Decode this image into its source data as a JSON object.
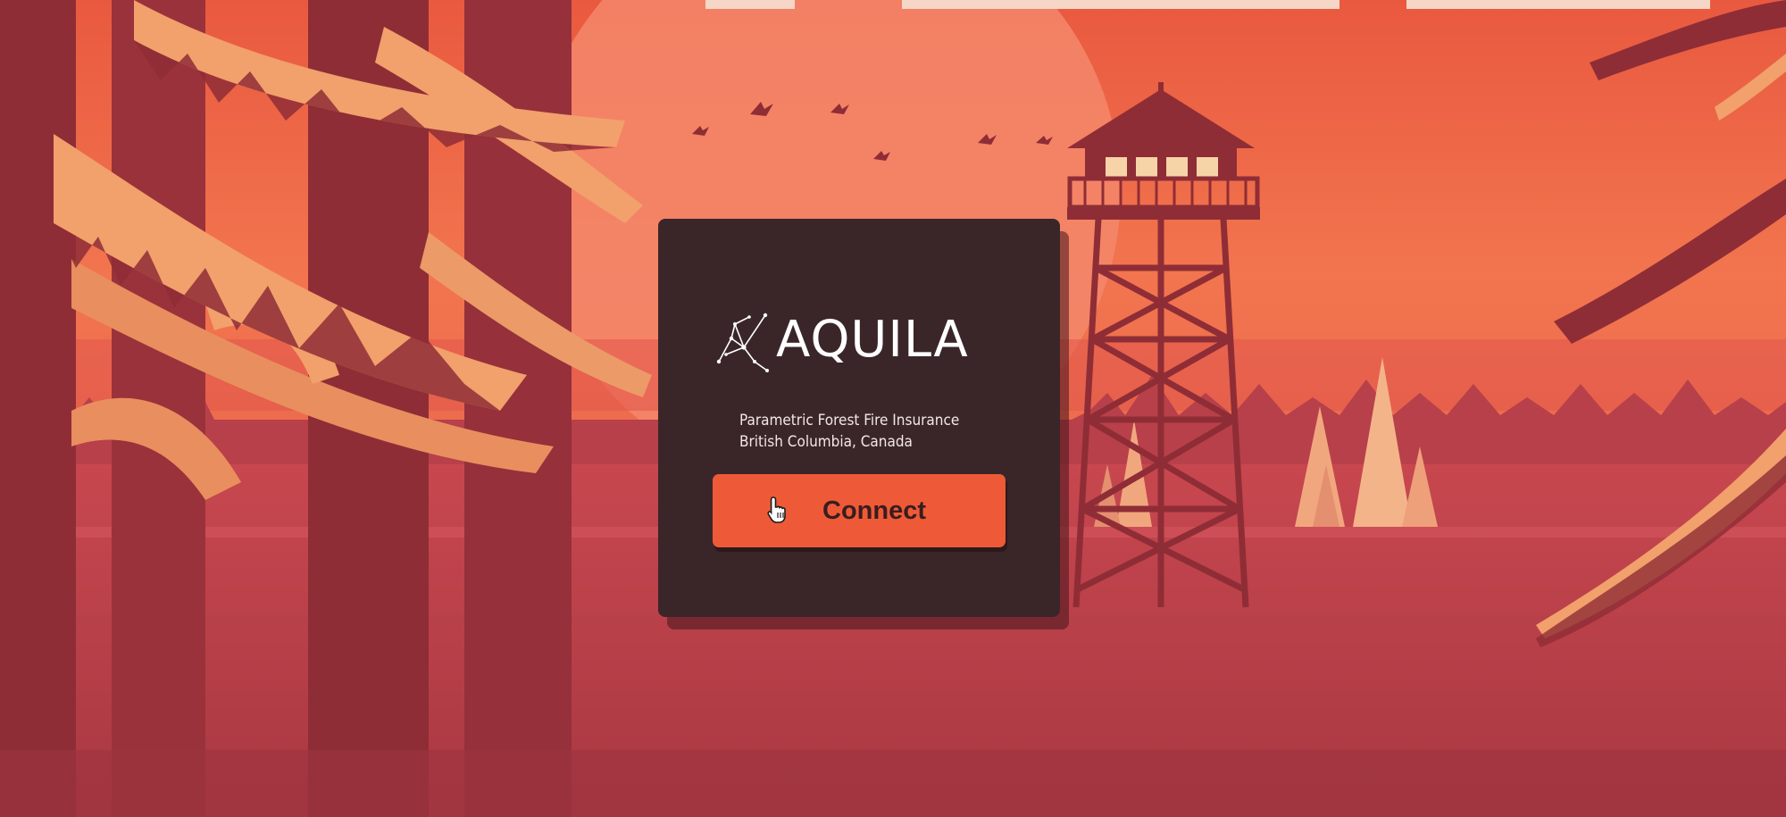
{
  "app": {
    "brand": "AQUILA",
    "tagline_line1": "Parametric Forest Fire Insurance",
    "tagline_line2": "British Columbia, Canada",
    "connect_label": "Connect"
  },
  "icons": {
    "logo": "constellation-eagle-icon",
    "cursor": "hand-pointer-icon"
  },
  "colors": {
    "card_bg": "#3a2629",
    "button_bg": "#ee5a38",
    "sky": "#f0664a",
    "forest_dark": "#8f2d36",
    "foliage": "#f2a06c"
  }
}
